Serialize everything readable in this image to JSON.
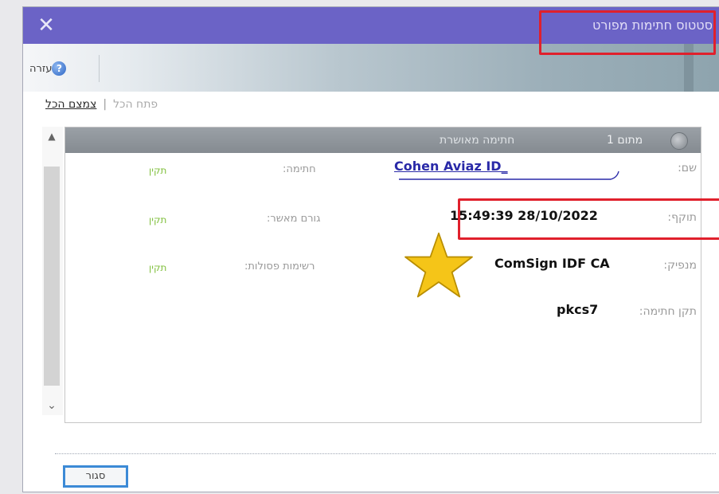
{
  "dialog": {
    "title": "סטטוס חתימות מפורט",
    "close_glyph": "✕"
  },
  "toolbar": {
    "help_label": "עזרה",
    "help_icon": "?"
  },
  "links": {
    "collapse_all": "צמצם הכל",
    "separator": "|",
    "expand_all": "פתח הכל"
  },
  "panel": {
    "header_badge": "מתום 1",
    "header_text": "חתימה מאושרת",
    "rows": [
      {
        "label": "שם:",
        "value": "Cohen Aviaz ID_",
        "mid_label": "חתימה:",
        "status": "תקין"
      },
      {
        "label": "תוקף:",
        "value": "15:49:39 28/10/2022",
        "mid_label": "גורם מאשר:",
        "status": "תקין"
      },
      {
        "label": "מנפיק:",
        "value": "ComSign IDF CA",
        "mid_label": "רשימות פסולות:",
        "status": "תקין"
      },
      {
        "label": "תקן חתימה:",
        "value": "pkcs7"
      }
    ]
  },
  "footer": {
    "close_button": "סגור"
  },
  "colors": {
    "titlebar": "#6b63c6",
    "highlight": "#e0202c",
    "valid_green": "#7fbf3b",
    "link_blue": "#2a2aa8",
    "star": "#f5c518"
  }
}
